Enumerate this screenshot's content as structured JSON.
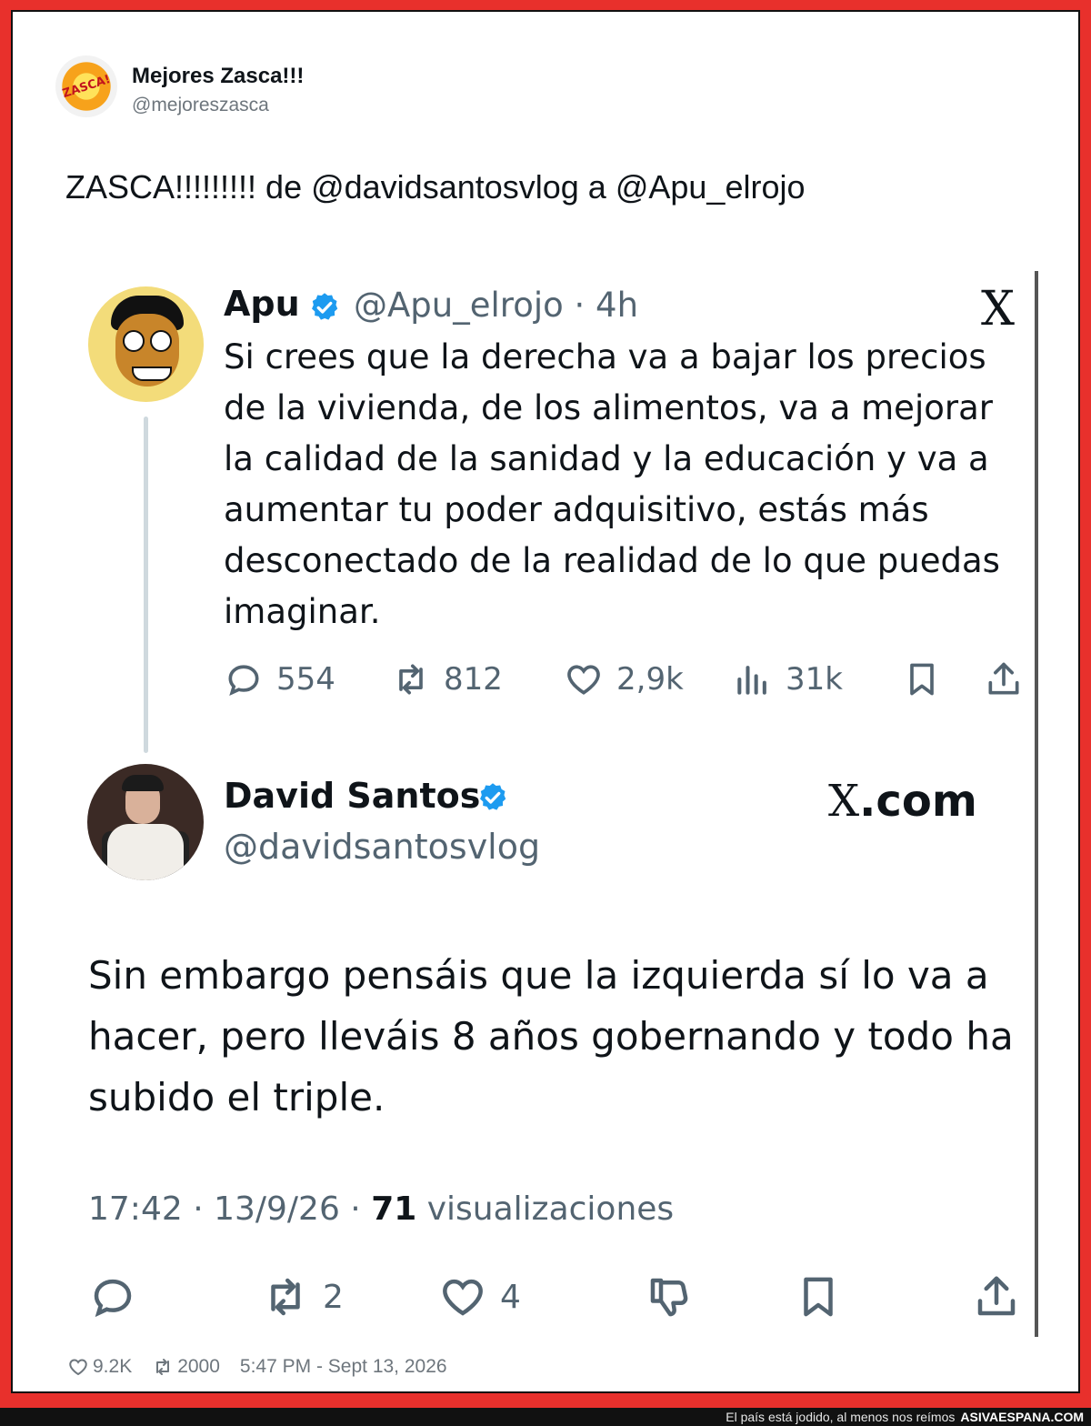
{
  "outer_tweet": {
    "author_name": "Mejores Zasca!!!",
    "author_handle": "@mejoreszasca",
    "avatar_text": "ZASCA!",
    "text": "ZASCA!!!!!!!!! de @davidsantosvlog a @Apu_elrojo",
    "likes": "9.2K",
    "retweets": "2000",
    "timestamp": "5:47 PM - Sept 13, 2026"
  },
  "quoted": {
    "original": {
      "name": "Apu",
      "handle_time": "@Apu_elrojo · 4h",
      "logo": "X",
      "text": "Si crees que la derecha va a bajar los precios de la vivienda, de los alimentos, va a mejorar la calidad de la sanidad y la educación y va a aumentar tu poder adquisitivo, estás más desconectado de la realidad de lo que puedas imaginar.",
      "replies": "554",
      "reposts": "812",
      "likes": "2,9k",
      "views": "31k"
    },
    "reply": {
      "name": "David Santos",
      "handle": "@davidsantosvlog",
      "site_logo_x": "X",
      "site_logo_text": ".com",
      "text": "Sin embargo pensáis que la izquierda sí lo va a hacer, pero lleváis 8 años gobernando y todo ha subido el triple.",
      "meta_time": "17:42 · 13/9/26 · ",
      "meta_views_count": "71",
      "meta_views_label": " visualizaciones",
      "reposts": "2",
      "likes": "4"
    }
  },
  "footer": {
    "tagline": "El país está jodido, al menos nos reímos",
    "brand": "ASIVAESPANA.COM"
  },
  "colors": {
    "border_red": "#e8302c",
    "verified_blue": "#1d9bf0",
    "muted_gray": "#536471"
  },
  "icons": [
    "verified-badge-icon",
    "reply-icon",
    "repost-icon",
    "like-icon",
    "views-icon",
    "bookmark-icon",
    "share-icon",
    "dislike-icon"
  ]
}
